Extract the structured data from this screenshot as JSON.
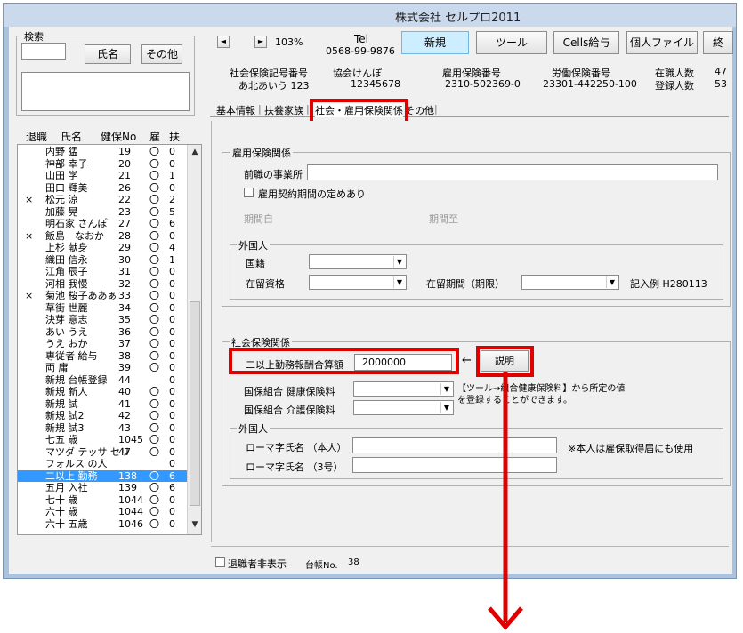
{
  "window": {
    "title": "株式会社 セルプロ2011"
  },
  "search": {
    "group_label": "検索",
    "name_button": "氏名",
    "other_button": "その他"
  },
  "list": {
    "headers": {
      "retired": "退職",
      "name": "氏名",
      "insurance_no": "健保No",
      "employment": "雇",
      "dependents": "扶"
    },
    "rows": [
      {
        "ret": "",
        "name": "内野 猛",
        "no": "19",
        "emp": "〇",
        "dep": "0"
      },
      {
        "ret": "",
        "name": "神部 幸子",
        "no": "20",
        "emp": "〇",
        "dep": "0"
      },
      {
        "ret": "",
        "name": "山田 学",
        "no": "21",
        "emp": "〇",
        "dep": "1"
      },
      {
        "ret": "",
        "name": "田口 輝美",
        "no": "26",
        "emp": "〇",
        "dep": "0"
      },
      {
        "ret": "×",
        "name": "松元 涼",
        "no": "22",
        "emp": "〇",
        "dep": "2"
      },
      {
        "ret": "",
        "name": "加藤 晃",
        "no": "23",
        "emp": "〇",
        "dep": "5"
      },
      {
        "ret": "",
        "name": "明石家 さんぽ",
        "no": "27",
        "emp": "〇",
        "dep": "6"
      },
      {
        "ret": "×",
        "name": "飯島　なおか",
        "no": "28",
        "emp": "〇",
        "dep": "0"
      },
      {
        "ret": "",
        "name": "上杉 献身",
        "no": "29",
        "emp": "〇",
        "dep": "4"
      },
      {
        "ret": "",
        "name": "織田 信永",
        "no": "30",
        "emp": "〇",
        "dep": "1"
      },
      {
        "ret": "",
        "name": "江角 辰子",
        "no": "31",
        "emp": "〇",
        "dep": "0"
      },
      {
        "ret": "",
        "name": "河相 我慢",
        "no": "32",
        "emp": "〇",
        "dep": "0"
      },
      {
        "ret": "×",
        "name": "菊池 桜子ああぁ",
        "no": "33",
        "emp": "〇",
        "dep": "0"
      },
      {
        "ret": "",
        "name": "草街 世麗",
        "no": "34",
        "emp": "〇",
        "dep": "0"
      },
      {
        "ret": "",
        "name": "決芽 意志",
        "no": "35",
        "emp": "〇",
        "dep": "0"
      },
      {
        "ret": "",
        "name": "あい うえ",
        "no": "36",
        "emp": "〇",
        "dep": "0"
      },
      {
        "ret": "",
        "name": "うえ おか",
        "no": "37",
        "emp": "〇",
        "dep": "0"
      },
      {
        "ret": "",
        "name": "専従者 給与",
        "no": "38",
        "emp": "〇",
        "dep": "0"
      },
      {
        "ret": "",
        "name": "両 庸",
        "no": "39",
        "emp": "〇",
        "dep": "0"
      },
      {
        "ret": "",
        "name": "新規 台帳登録",
        "no": "44",
        "emp": "",
        "dep": "0"
      },
      {
        "ret": "",
        "name": "新規 新人",
        "no": "40",
        "emp": "〇",
        "dep": "0"
      },
      {
        "ret": "",
        "name": "新規 試",
        "no": "41",
        "emp": "〇",
        "dep": "0"
      },
      {
        "ret": "",
        "name": "新規 試2",
        "no": "42",
        "emp": "〇",
        "dep": "0"
      },
      {
        "ret": "",
        "name": "新規 試3",
        "no": "43",
        "emp": "〇",
        "dep": "0"
      },
      {
        "ret": "",
        "name": "七五 歳",
        "no": "1045",
        "emp": "〇",
        "dep": "0"
      },
      {
        "ret": "",
        "name": "マツダ テッサ セリ",
        "no": "47",
        "emp": "〇",
        "dep": "0"
      },
      {
        "ret": "",
        "name": "フォルス の人",
        "no": "",
        "emp": "",
        "dep": "0"
      },
      {
        "ret": "",
        "name": "二以上 勤務",
        "no": "138",
        "emp": "〇",
        "dep": "6",
        "selected": true
      },
      {
        "ret": "",
        "name": "五月 入社",
        "no": "139",
        "emp": "〇",
        "dep": "6"
      },
      {
        "ret": "",
        "name": "七十 歳",
        "no": "1044",
        "emp": "〇",
        "dep": "0"
      },
      {
        "ret": "",
        "name": "六十 歳",
        "no": "1044",
        "emp": "〇",
        "dep": "0"
      },
      {
        "ret": "",
        "name": "六十 五歳",
        "no": "1046",
        "emp": "〇",
        "dep": "0"
      }
    ]
  },
  "toolbar": {
    "zoom": "103%",
    "tel_label": "Tel",
    "tel_number": "0568-99-9876",
    "new_button": "新規",
    "tools_button": "ツール",
    "cells_salary_button": "Cells給与",
    "personal_file_button": "個人ファイル",
    "overflow_button": "終"
  },
  "info": {
    "social_insurance_symbol_label": "社会保険記号番号",
    "social_insurance_symbol_value": "あ北あいう 123",
    "kyokai_kenpo_label": "協会けんぽ",
    "kyokai_kenpo_value": "12345678",
    "employment_insurance_label": "雇用保険番号",
    "employment_insurance_value": "2310-502369-0",
    "labor_insurance_label": "労働保険番号",
    "labor_insurance_value": "23301-442250-100",
    "active_count_label": "在職人数",
    "active_count_value": "47",
    "registered_count_label": "登録人数",
    "registered_count_value": "53"
  },
  "tabs": [
    "基本情報",
    "扶養家族",
    "社会・雇用保険関係",
    "その他"
  ],
  "employment_insurance": {
    "group_label": "雇用保険関係",
    "prev_employer_label": "前職の事業所",
    "prev_employer_value": "",
    "contract_period_checkbox": "雇用契約期間の定めあり",
    "period_start_label": "期間自",
    "period_end_label": "期間至"
  },
  "foreigner": {
    "group_label": "外国人",
    "nationality_label": "国籍",
    "residence_status_label": "在留資格",
    "residence_period_label": "在留期間（期限）",
    "example_text": "記入例  H280113"
  },
  "social_insurance": {
    "group_label": "社会保険関係",
    "multi_work_label": "二以上勤務報酬合算額",
    "multi_work_value": "2000000",
    "arrow_glyph": "←",
    "explain_button": "説明",
    "health_premium_label": "国保組合  健康保険料",
    "care_premium_label": "国保組合  介護保険料",
    "note_line1": "【ツール→組合健康保険料】から所定の値",
    "note_line2": "を登録することができます。",
    "foreigner_group_label": "外国人",
    "romaji_name_label": "ローマ字氏名 （本人）",
    "romaji_name3_label": "ローマ字氏名 （3号）",
    "romaji_note": "※本人は雇保取得届にも使用"
  },
  "footer": {
    "hide_retired_checkbox": "退職者非表示",
    "ledger_no_label": "台帳No.",
    "ledger_no_value": "38"
  },
  "colors": {
    "highlight_red": "#e00000",
    "selected_row": "#3399ff",
    "new_button_bg": "#cdeefe"
  }
}
